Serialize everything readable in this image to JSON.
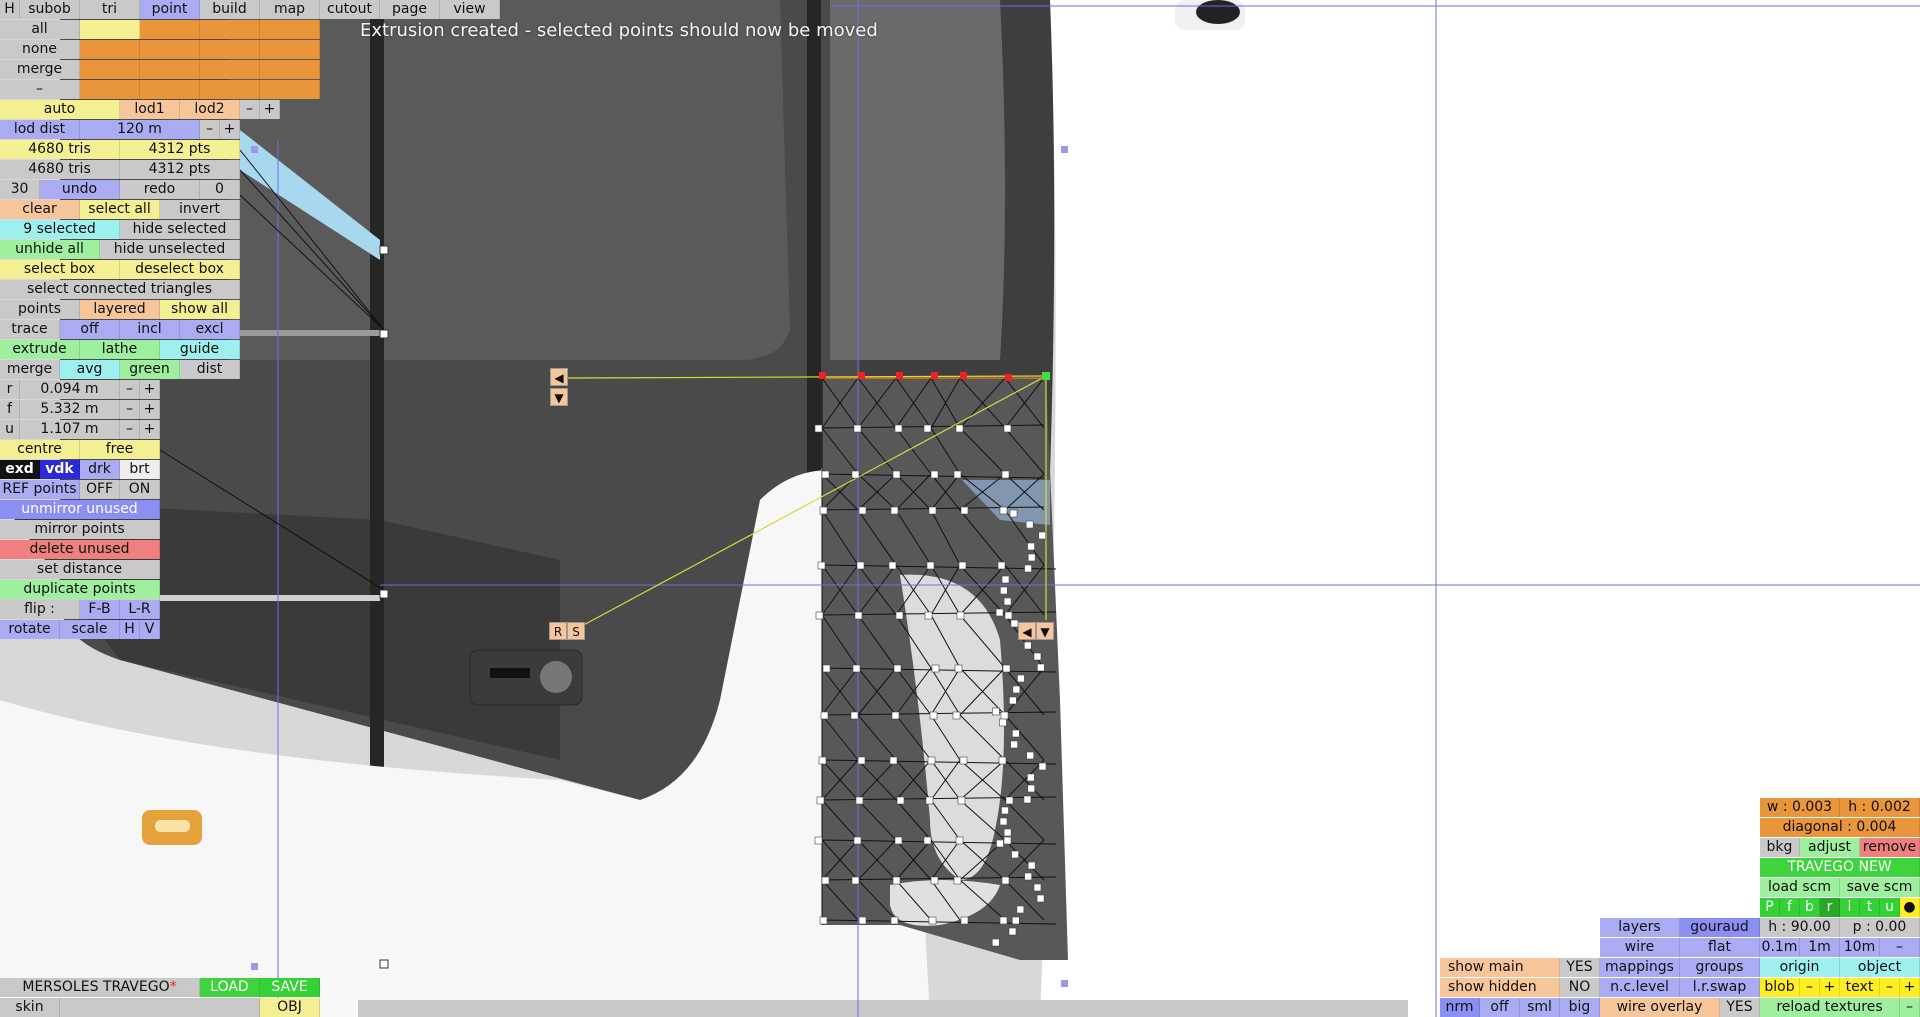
{
  "status_message": "Extrusion created - selected points should now be moved",
  "menu": {
    "h": "H",
    "subob": "subob",
    "tri": "tri",
    "point": "point",
    "build": "build",
    "map": "map",
    "cutout": "cutout",
    "page": "page",
    "view": "view"
  },
  "layer_rows": {
    "all": "all",
    "none": "none",
    "merge": "merge",
    "minus": "–"
  },
  "lod": {
    "auto": "auto",
    "lod1": "lod1",
    "lod2": "lod2",
    "minus": "–",
    "plus": "+",
    "dist_label": "lod dist",
    "dist_value": "120 m"
  },
  "stats": {
    "tris_1": "4680 tris",
    "pts_1": "4312 pts",
    "tris_2": "4680 tris",
    "pts_2": "4312 pts"
  },
  "undo": {
    "count": "30",
    "undo": "undo",
    "redo": "redo",
    "zero": "0"
  },
  "selection": {
    "clear": "clear",
    "select_all": "select all",
    "invert": "invert",
    "selected": "9 selected",
    "hide_selected": "hide selected",
    "unhide_all": "unhide all",
    "hide_unselected": "hide unselected",
    "select_box": "select box",
    "deselect_box": "deselect box",
    "connected": "select connected triangles"
  },
  "points": {
    "points": "points",
    "layered": "layered",
    "show_all": "show all"
  },
  "trace": {
    "trace": "trace",
    "off": "off",
    "incl": "incl",
    "excl": "excl"
  },
  "build": {
    "extrude": "extrude",
    "lathe": "lathe",
    "guide": "guide",
    "merge": "merge",
    "avg": "avg",
    "green": "green",
    "dist": "dist"
  },
  "coords": {
    "r": "r",
    "r_val": "0.094 m",
    "f": "f",
    "f_val": "5.332 m",
    "u": "u",
    "u_val": "1.107 m",
    "minus": "–",
    "plus": "+"
  },
  "centre": {
    "centre": "centre",
    "free": "free"
  },
  "display_mode": {
    "exd": "exd",
    "vdk": "vdk",
    "drk": "drk",
    "brt": "brt"
  },
  "ref": {
    "label": "REF points",
    "off": "OFF",
    "on": "ON"
  },
  "ops": {
    "unmirror": "unmirror unused",
    "mirror": "mirror points",
    "delete": "delete unused",
    "set_distance": "set distance",
    "duplicate": "duplicate points"
  },
  "flip": {
    "label": "flip :",
    "fb": "F-B",
    "lr": "L-R"
  },
  "transform": {
    "rotate": "rotate",
    "scale": "scale",
    "h": "H",
    "v": "V"
  },
  "file": {
    "name": "MERSOLES TRAVEGO",
    "modified": "*",
    "load": "LOAD",
    "save": "SAVE",
    "skin": "skin",
    "obj": "OBJ"
  },
  "handles": {
    "r": "R",
    "s": "S",
    "left": "◀",
    "down": "▼"
  },
  "right": {
    "w": "w : 0.003",
    "h": "h : 0.002",
    "diagonal": "diagonal : 0.004",
    "bkg": "bkg",
    "adjust": "adjust",
    "remove": "remove",
    "model": "TRAVEGO NEW",
    "load_scm": "load scm",
    "save_scm": "save scm",
    "views": [
      "P",
      "f",
      "b",
      "r",
      "l",
      "t",
      "u",
      "●"
    ],
    "layers": "layers",
    "gouraud": "gouraud",
    "h_angle": "h : 90.00",
    "p_angle": "p : 0.00",
    "wire": "wire",
    "flat": "flat",
    "g01": "0.1m",
    "g1": "1m",
    "g10": "10m",
    "gminus": "–",
    "show_main": "show main",
    "yes": "YES",
    "mappings": "mappings",
    "groups": "groups",
    "origin": "origin",
    "object": "object",
    "show_hidden": "show hidden",
    "no": "NO",
    "nclevel": "n.c.level",
    "lrswap": "l.r.swap",
    "blob": "blob",
    "text": "text",
    "minus": "–",
    "plus": "+",
    "nrm": "nrm",
    "off": "off",
    "sml": "sml",
    "big": "big",
    "wire_overlay": "wire overlay",
    "reload": "reload textures"
  }
}
